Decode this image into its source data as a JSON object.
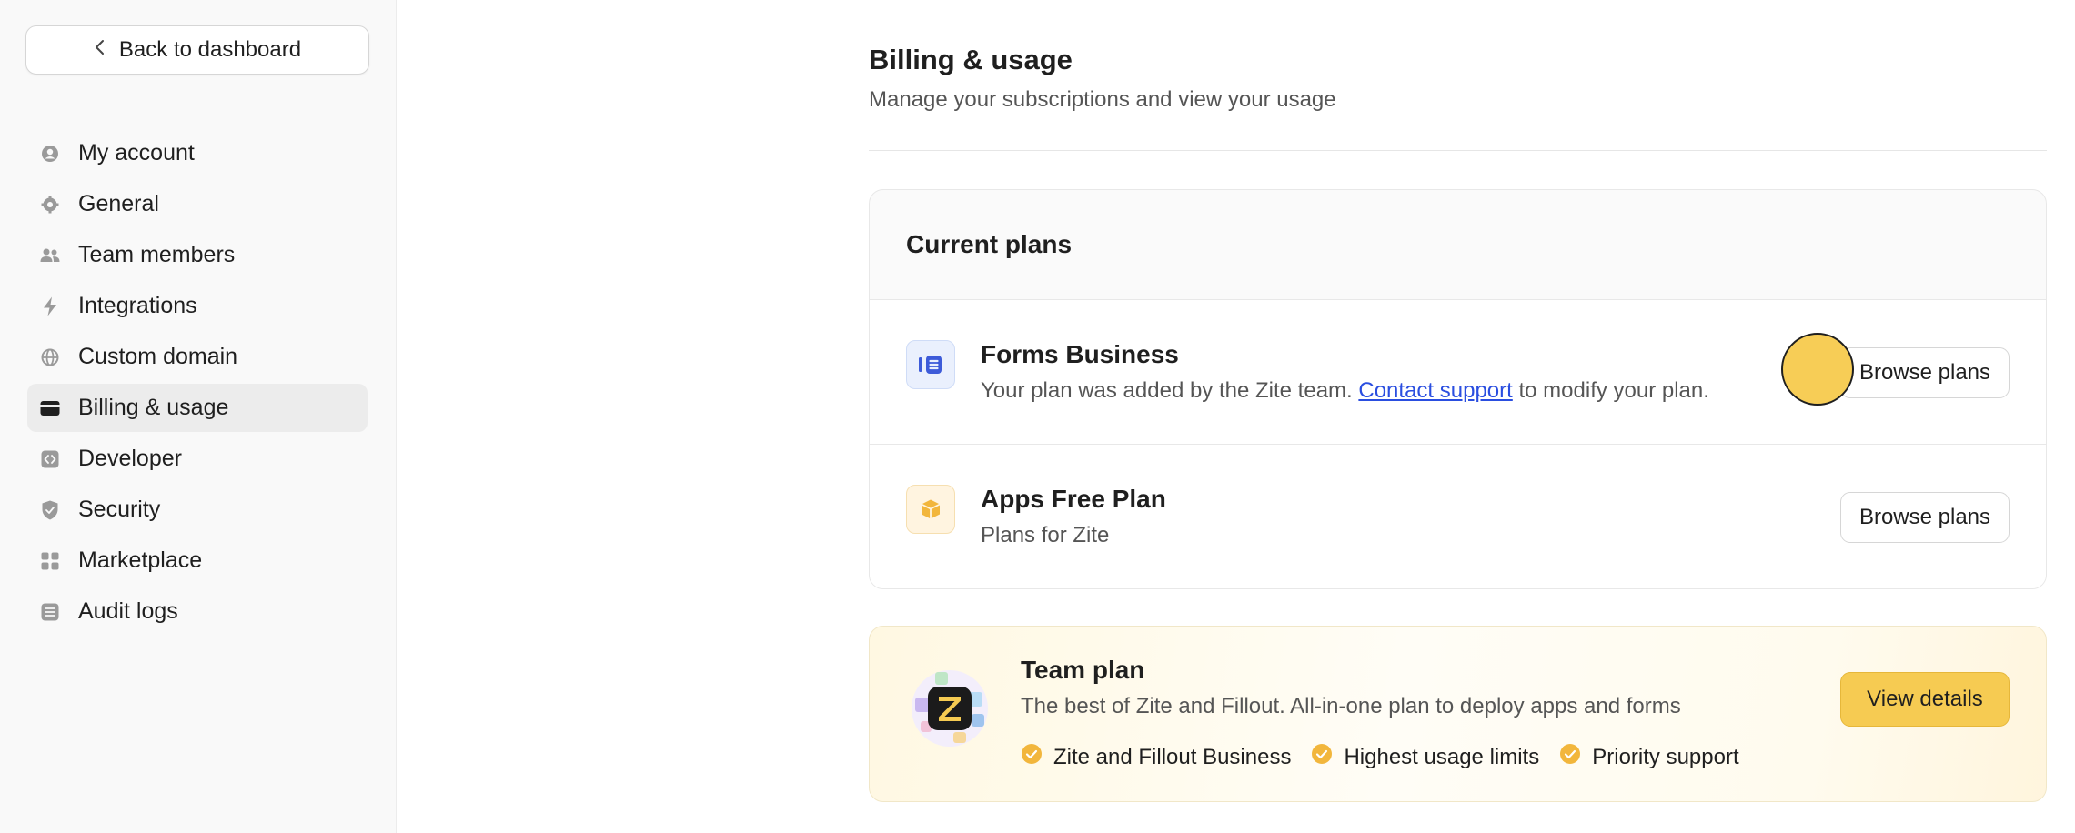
{
  "sidebar": {
    "back_label": "Back to dashboard",
    "items": [
      {
        "label": "My account",
        "icon": "user-circle-icon",
        "active": false
      },
      {
        "label": "General",
        "icon": "gear-icon",
        "active": false
      },
      {
        "label": "Team members",
        "icon": "users-icon",
        "active": false
      },
      {
        "label": "Integrations",
        "icon": "lightning-icon",
        "active": false
      },
      {
        "label": "Custom domain",
        "icon": "globe-icon",
        "active": false
      },
      {
        "label": "Billing & usage",
        "icon": "credit-card-icon",
        "active": true
      },
      {
        "label": "Developer",
        "icon": "code-icon",
        "active": false
      },
      {
        "label": "Security",
        "icon": "shield-icon",
        "active": false
      },
      {
        "label": "Marketplace",
        "icon": "grid-icon",
        "active": false
      },
      {
        "label": "Audit logs",
        "icon": "list-icon",
        "active": false
      }
    ]
  },
  "page": {
    "title": "Billing & usage",
    "subtitle": "Manage your subscriptions and view your usage"
  },
  "current_plans": {
    "header": "Current plans",
    "plans": [
      {
        "name": "Forms Business",
        "desc_prefix": "Your plan was added by the Zite team.",
        "desc_link": "Contact support",
        "desc_suffix": "to modify your plan.",
        "button": "Browse plans",
        "icon": "forms-icon"
      },
      {
        "name": "Apps Free Plan",
        "desc": "Plans for Zite",
        "button": "Browse plans",
        "icon": "cube-icon"
      }
    ]
  },
  "team_plan": {
    "name": "Team plan",
    "desc": "The best of Zite and Fillout. All-in-one plan to deploy apps and forms",
    "features": [
      "Zite and Fillout Business",
      "Highest usage limits",
      "Priority support"
    ],
    "button": "View details",
    "logo_letter": "Z"
  },
  "colors": {
    "accent_yellow": "#f6cb52",
    "link_blue": "#2a4ee0",
    "forms_blue": "#3d5bd9",
    "apps_orange": "#f2b63c"
  }
}
